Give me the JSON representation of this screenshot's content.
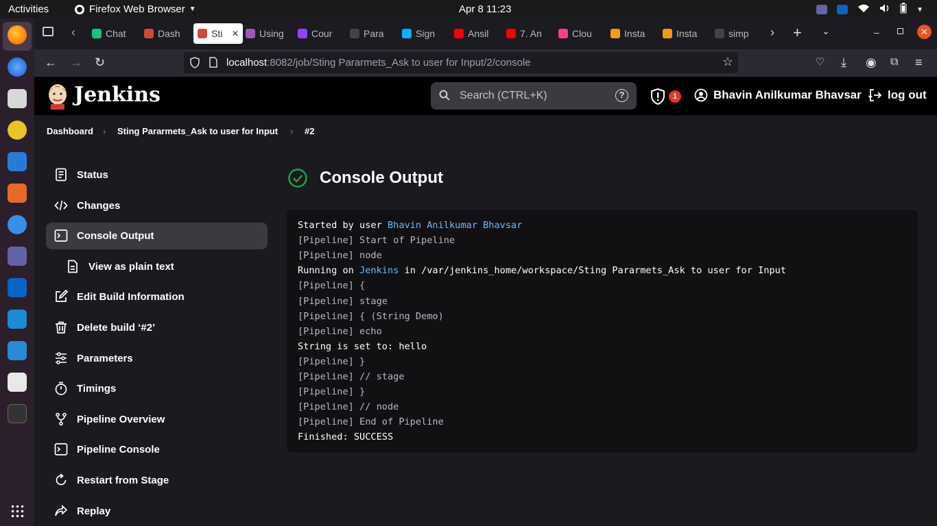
{
  "os": {
    "activities": "Activities",
    "app_name": "Firefox Web Browser",
    "clock": "Apr 8  11:23"
  },
  "browser": {
    "tabs": [
      {
        "label": "Chat",
        "color": "#19c37d"
      },
      {
        "label": "Dash",
        "color": "#d24939"
      },
      {
        "label": "Sti",
        "color": "#d24939",
        "active": true
      },
      {
        "label": "Using",
        "color": "#9b59b6"
      },
      {
        "label": "Cour",
        "color": "#8e44ff"
      },
      {
        "label": "Para",
        "color": "#444444"
      },
      {
        "label": "Sign",
        "color": "#00b3ff"
      },
      {
        "label": "Ansil",
        "color": "#ff0000"
      },
      {
        "label": "7. An",
        "color": "#ff0000"
      },
      {
        "label": "Clou",
        "color": "#ff3c8e"
      },
      {
        "label": "Insta",
        "color": "#f39c12"
      },
      {
        "label": "Insta",
        "color": "#f39c12"
      },
      {
        "label": "simp",
        "color": "#444444"
      }
    ],
    "url_host": "localhost",
    "url_rest": ":8082/job/Sting Pararmets_Ask to user for Input/2/console"
  },
  "jenkins": {
    "title": "Jenkins",
    "search_placeholder": "Search (CTRL+K)",
    "alert_count": "1",
    "user_name": "Bhavin Anilkumar Bhavsar",
    "logout": "log out"
  },
  "breadcrumb": {
    "dashboard": "Dashboard",
    "job": "Sting Pararmets_Ask to user for Input",
    "build": "#2"
  },
  "sidebar": {
    "items": [
      {
        "label": "Status",
        "icon": "document-icon"
      },
      {
        "label": "Changes",
        "icon": "code-icon"
      },
      {
        "label": "Console Output",
        "icon": "terminal-icon",
        "selected": true
      },
      {
        "label": "View as plain text",
        "icon": "file-text-icon",
        "indent": true
      },
      {
        "label": "Edit Build Information",
        "icon": "edit-icon"
      },
      {
        "label": "Delete build ‘#2’",
        "icon": "trash-icon"
      },
      {
        "label": "Parameters",
        "icon": "sliders-icon"
      },
      {
        "label": "Timings",
        "icon": "stopwatch-icon"
      },
      {
        "label": "Pipeline Overview",
        "icon": "branch-icon"
      },
      {
        "label": "Pipeline Console",
        "icon": "terminal-icon"
      },
      {
        "label": "Restart from Stage",
        "icon": "restart-icon"
      },
      {
        "label": "Replay",
        "icon": "replay-icon"
      }
    ]
  },
  "main": {
    "title": "Console Output",
    "status_color": "#1ea446"
  },
  "console": {
    "lines": [
      {
        "pre": "Started by user ",
        "link": "Bhavin Anilkumar Bhavsar",
        "post": "",
        "dim": false
      },
      {
        "pre": "[Pipeline] Start of Pipeline",
        "dim": true
      },
      {
        "pre": "[Pipeline] node",
        "dim": true
      },
      {
        "pre": "Running on ",
        "link": "Jenkins",
        "post": " in /var/jenkins_home/workspace/Sting Pararmets_Ask to user for Input",
        "dim": false
      },
      {
        "pre": "[Pipeline] {",
        "dim": true
      },
      {
        "pre": "[Pipeline] stage",
        "dim": true
      },
      {
        "pre": "[Pipeline] { (String Demo)",
        "dim": true
      },
      {
        "pre": "[Pipeline] echo",
        "dim": true
      },
      {
        "pre": "String is set to: hello",
        "dim": false
      },
      {
        "pre": "[Pipeline] }",
        "dim": true
      },
      {
        "pre": "[Pipeline] // stage",
        "dim": true
      },
      {
        "pre": "[Pipeline] }",
        "dim": true
      },
      {
        "pre": "[Pipeline] // node",
        "dim": true
      },
      {
        "pre": "[Pipeline] End of Pipeline",
        "dim": true
      },
      {
        "pre": "Finished: SUCCESS",
        "dim": false
      }
    ]
  }
}
